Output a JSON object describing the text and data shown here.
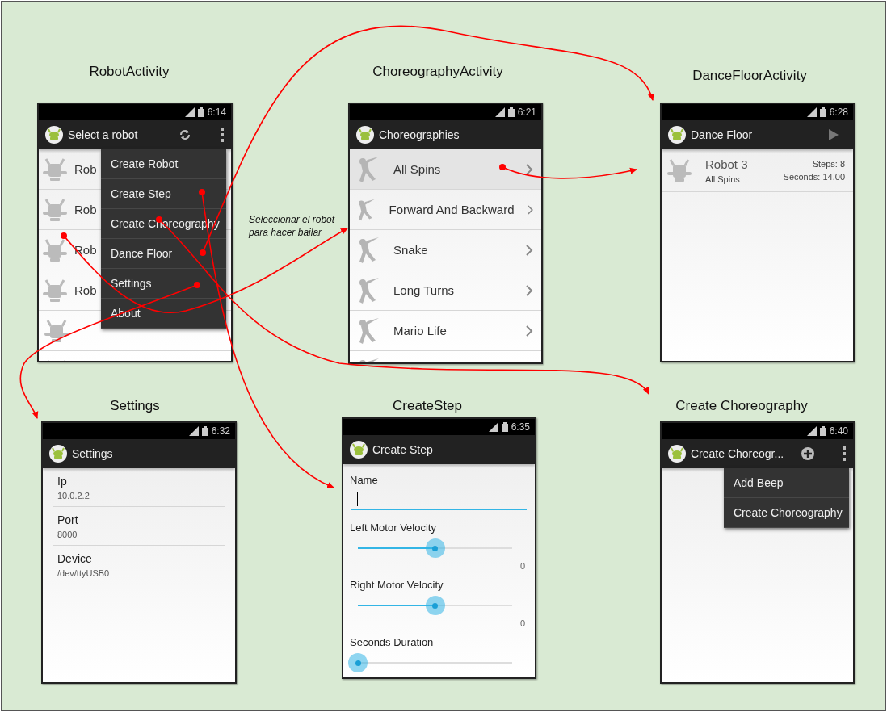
{
  "annotation": "Seleccionar el robot para hacer bailar",
  "robot_activity": {
    "caption": "RobotActivity",
    "status_time": "6:14",
    "title": "Select a robot",
    "robots": [
      {
        "name": "Rob"
      },
      {
        "name": "Rob"
      },
      {
        "name": "Rob"
      },
      {
        "name": "Rob"
      }
    ],
    "menu": [
      "Create Robot",
      "Create Step",
      "Create Choreography",
      "Dance Floor",
      "Settings",
      "About"
    ]
  },
  "choreography_activity": {
    "caption": "ChoreographyActivity",
    "status_time": "6:21",
    "title": "Choreographies",
    "choreographies": [
      {
        "name": "All Spins",
        "selected": true
      },
      {
        "name": "Forward And Backward",
        "selected": false
      },
      {
        "name": "Snake",
        "selected": false
      },
      {
        "name": "Long Turns",
        "selected": false
      },
      {
        "name": "Mario Life",
        "selected": false
      }
    ]
  },
  "dance_floor_activity": {
    "caption": "DanceFloorActivity",
    "status_time": "6:28",
    "title": "Dance Floor",
    "entry": {
      "robot": "Robot 3",
      "choreography": "All Spins",
      "steps": "Steps: 8",
      "seconds": "Seconds: 14.00"
    }
  },
  "settings": {
    "caption": "Settings",
    "status_time": "6:32",
    "title": "Settings",
    "preferences": [
      {
        "label": "Ip",
        "value": "10.0.2.2"
      },
      {
        "label": "Port",
        "value": "8000"
      },
      {
        "label": "Device",
        "value": "/dev/ttyUSB0"
      }
    ]
  },
  "create_step": {
    "caption": "CreateStep",
    "status_time": "6:35",
    "title": "Create Step",
    "name_label": "Name",
    "sliders": [
      {
        "label": "Left Motor Velocity",
        "level": 0.5,
        "reading": "0"
      },
      {
        "label": "Right Motor Velocity",
        "level": 0.5,
        "reading": "0"
      },
      {
        "label": "Seconds Duration",
        "level": 0
      }
    ]
  },
  "create_choreography": {
    "caption": "Create Choreography",
    "status_time": "6:40",
    "title": "Create Choreogr...",
    "menu": [
      "Add Beep",
      "Create Choreography"
    ]
  }
}
